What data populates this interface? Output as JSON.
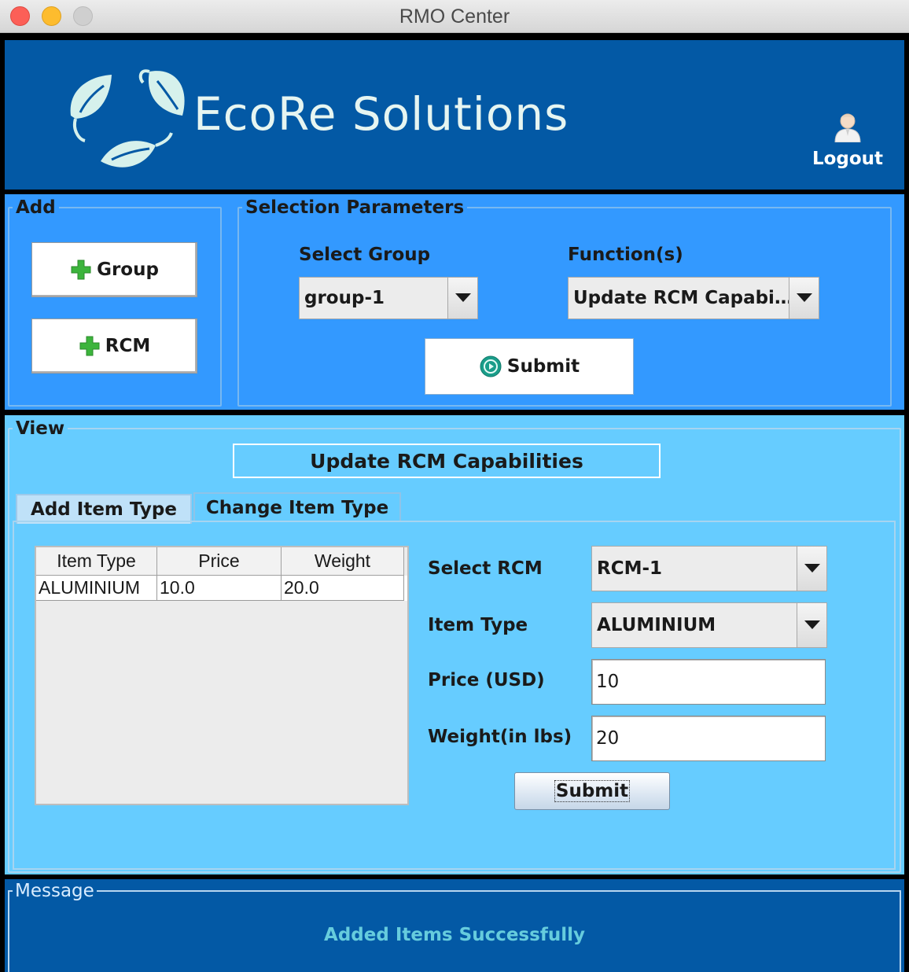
{
  "window": {
    "title": "RMO Center"
  },
  "header": {
    "logo_text": "EcoRe Solutions",
    "logout_label": "Logout"
  },
  "add_panel": {
    "legend": "Add",
    "group_button": "Group",
    "rcm_button": "RCM"
  },
  "selection": {
    "legend": "Selection Parameters",
    "group_label": "Select Group",
    "group_value": "group-1",
    "function_label": "Function(s)",
    "function_value": "Update RCM Capabi…",
    "submit_label": "Submit"
  },
  "view": {
    "legend": "View",
    "title": "Update RCM Capabilities",
    "tabs": [
      {
        "label": "Add Item Type"
      },
      {
        "label": "Change Item Type"
      }
    ],
    "table": {
      "columns": [
        "Item Type",
        "Price",
        "Weight"
      ],
      "rows": [
        [
          "ALUMINIUM",
          "10.0",
          "20.0"
        ]
      ]
    },
    "form": {
      "rcm_label": "Select RCM",
      "rcm_value": "RCM-1",
      "item_type_label": "Item Type",
      "item_type_value": "ALUMINIUM",
      "price_label": "Price (USD)",
      "price_value": "10",
      "weight_label": "Weight(in lbs)",
      "weight_value": "20",
      "submit_label": "Submit"
    }
  },
  "message": {
    "legend": "Message",
    "text": "Added Items Successfully"
  },
  "colors": {
    "header_bg": "#0359a5",
    "selection_bg": "#3399ff",
    "view_bg": "#66ccff",
    "message_text": "#66ccdd"
  }
}
